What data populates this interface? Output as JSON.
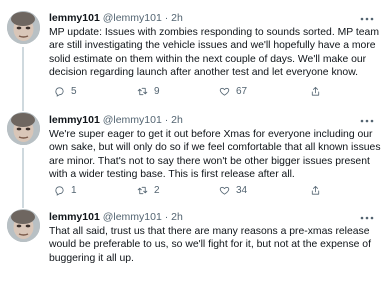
{
  "colors": {
    "text_primary": "#0f1419",
    "text_secondary": "#536471",
    "divider": "#eff3f4",
    "thread_line": "#cfd9de"
  },
  "tweets": [
    {
      "name": "lemmy101",
      "handle": "@lemmy101",
      "dot": "·",
      "time": "2h",
      "text": "MP update: Issues with zombies responding to sounds sorted. MP team are still investigating the vehicle issues and we'll hopefully have a more solid estimate on them within the next couple of days. We'll make our decision regarding launch after another test and let everyone know.",
      "reply_count": "5",
      "retweet_count": "9",
      "like_count": "67"
    },
    {
      "name": "lemmy101",
      "handle": "@lemmy101",
      "dot": "·",
      "time": "2h",
      "text": "We're super eager to get it out before Xmas for everyone including our own sake, but will only do so if we feel comfortable that all known issues are minor. That's not to say there won't be other bigger issues present with a wider testing base. This is first release after all.",
      "reply_count": "1",
      "retweet_count": "2",
      "like_count": "34"
    },
    {
      "name": "lemmy101",
      "handle": "@lemmy101",
      "dot": "·",
      "time": "2h",
      "text": "That all said, trust us that there are many reasons a pre-xmas release would be preferable to us, so we'll fight for it, but not at the expense of buggering it all up."
    }
  ],
  "icons": {
    "reply": "reply-icon",
    "retweet": "retweet-icon",
    "like": "heart-icon",
    "share": "share-icon",
    "more": "more-icon",
    "avatar": "avatar-image"
  }
}
